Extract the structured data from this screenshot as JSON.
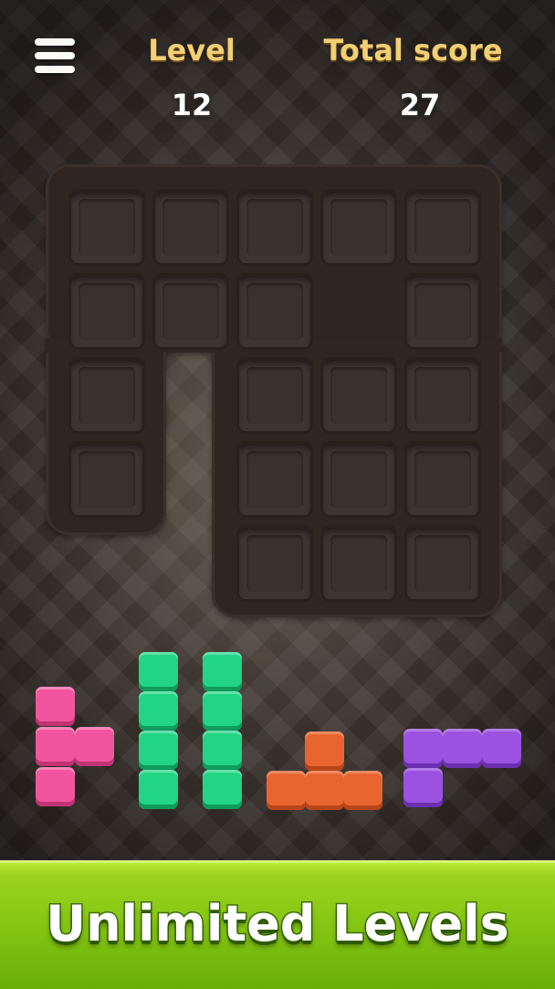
{
  "header": {
    "level_label": "Level",
    "level_value": "12",
    "score_label": "Total score",
    "score_value": "27",
    "menu_icon": "hamburger-menu-icon"
  },
  "board": {
    "columns": 5,
    "rows": 5,
    "missing_cells": [
      [
        1,
        3
      ],
      [
        2,
        1
      ],
      [
        3,
        1
      ],
      [
        4,
        0
      ],
      [
        4,
        1
      ]
    ],
    "cell_state": "empty"
  },
  "pieces": [
    {
      "name": "pink-t-piece",
      "color": "#f2559f"
    },
    {
      "name": "green-i-piece-1",
      "color": "#22d485"
    },
    {
      "name": "green-i-piece-2",
      "color": "#22d485"
    },
    {
      "name": "orange-t-piece",
      "color": "#e9652f"
    },
    {
      "name": "purple-l-piece",
      "color": "#9b52e0"
    }
  ],
  "banner": {
    "text": "Unlimited Levels",
    "color": "#8cc91a"
  }
}
